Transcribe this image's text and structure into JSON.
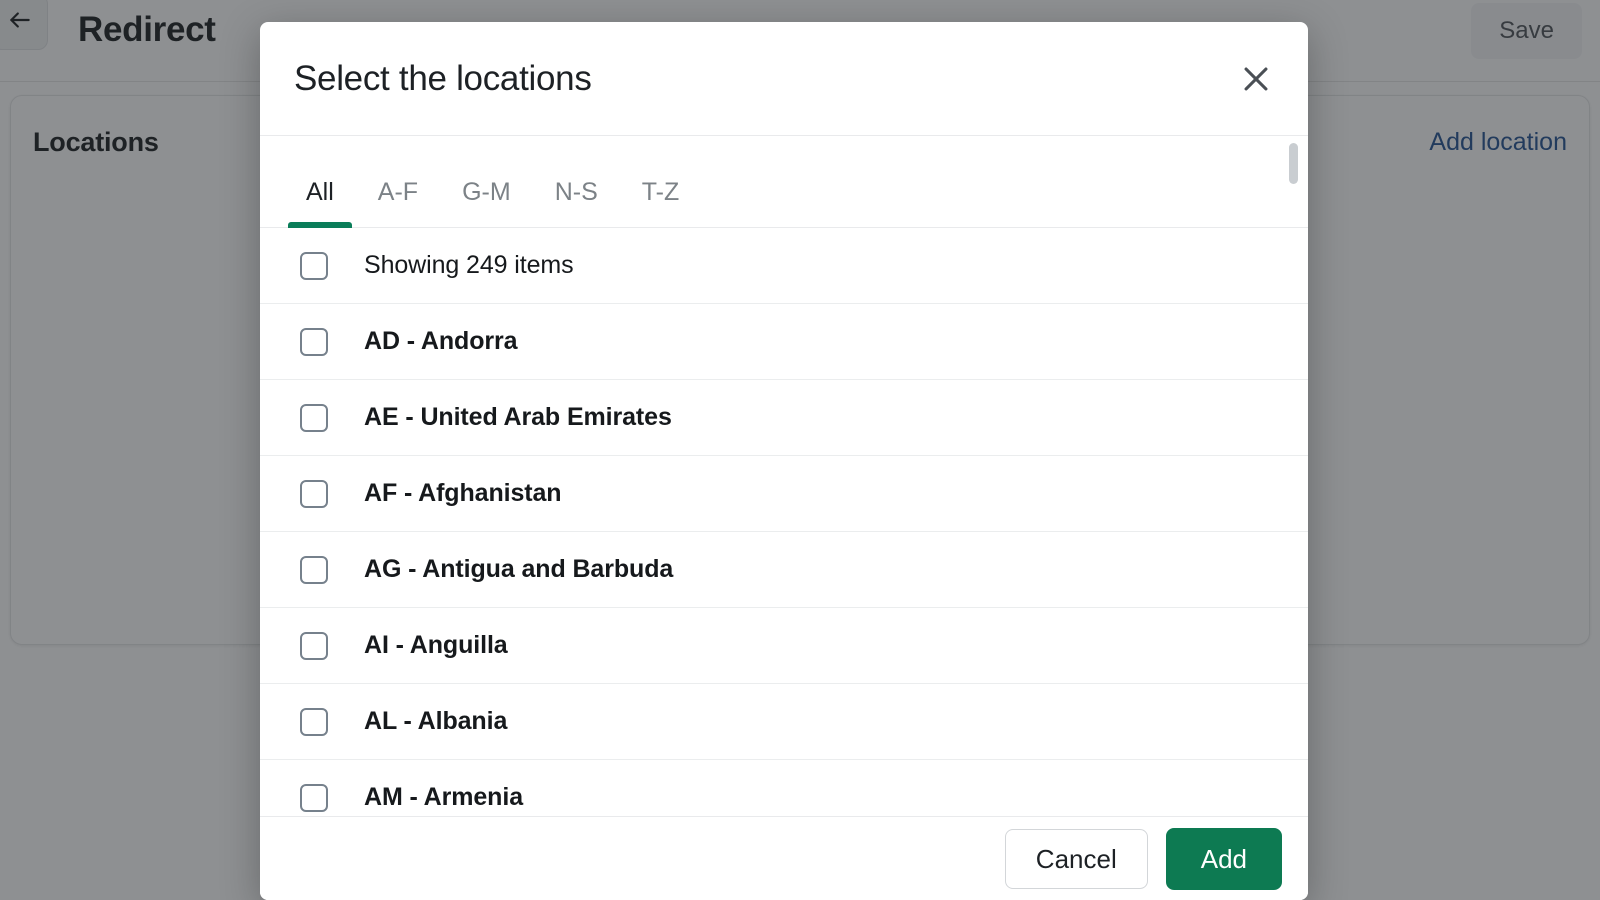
{
  "background": {
    "back_icon": "arrow-left-icon",
    "title": "Redirect",
    "save_label": "Save",
    "card": {
      "title": "Locations",
      "add_link": "Add location"
    }
  },
  "modal": {
    "title": "Select the locations",
    "close_icon": "close-icon",
    "tabs": [
      {
        "label": "All",
        "active": true
      },
      {
        "label": "A-F",
        "active": false
      },
      {
        "label": "G-M",
        "active": false
      },
      {
        "label": "N-S",
        "active": false
      },
      {
        "label": "T-Z",
        "active": false
      }
    ],
    "summary_row": {
      "label": "Showing 249 items",
      "checked": false
    },
    "items": [
      {
        "label": "AD - Andorra",
        "checked": false
      },
      {
        "label": "AE - United Arab Emirates",
        "checked": false
      },
      {
        "label": "AF - Afghanistan",
        "checked": false
      },
      {
        "label": "AG - Antigua and Barbuda",
        "checked": false
      },
      {
        "label": "AI - Anguilla",
        "checked": false
      },
      {
        "label": "AL - Albania",
        "checked": false
      },
      {
        "label": "AM - Armenia",
        "checked": false
      }
    ],
    "footer": {
      "cancel_label": "Cancel",
      "add_label": "Add"
    },
    "scrollbar": {
      "thumb_top_pct": 1,
      "thumb_height_pct": 6
    }
  },
  "colors": {
    "accent_green": "#0a7d59",
    "add_button_green": "#0d7a52",
    "link_blue": "#1f4f91",
    "text_dark": "#16191c",
    "text_muted": "#7c8287",
    "divider": "#ebedee",
    "checkbox_border": "#76818c"
  }
}
